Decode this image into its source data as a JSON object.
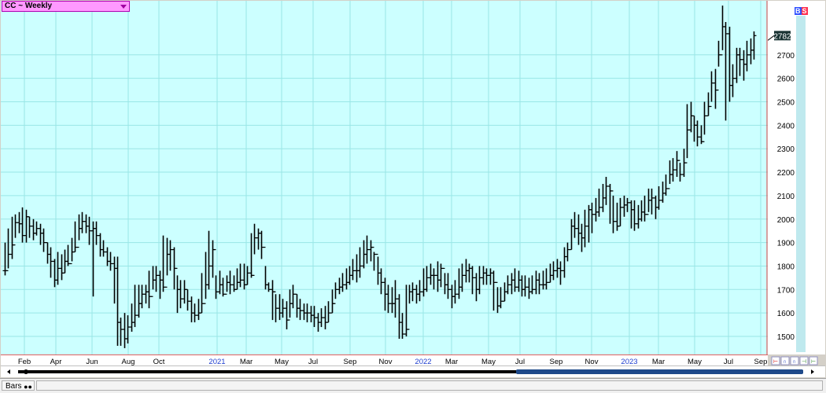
{
  "symbol_selector": {
    "label": "CC ~ Weekly"
  },
  "badges": {
    "buy": "B",
    "sell": "S"
  },
  "last_price_label": "2782",
  "bottom_tab": {
    "label": "Bars"
  },
  "colors": {
    "plot_bg": "#ccffff",
    "grid": "#99e6e6",
    "bars": "#000000",
    "price_badge": "#1a3333",
    "divider": "#e04040",
    "year_label": "#1f3fd0"
  },
  "chart_data": {
    "type": "ohlc",
    "title": "CC ~ Weekly",
    "xlabel": "",
    "ylabel": "",
    "ylim": [
      1450,
      2930
    ],
    "yticks": [
      1500,
      1600,
      1700,
      1800,
      1900,
      2000,
      2100,
      2200,
      2300,
      2400,
      2500,
      2600,
      2700
    ],
    "grid": true,
    "xticks": [
      "Feb",
      "Apr",
      "Jun",
      "Aug",
      "Oct",
      "2021",
      "Mar",
      "May",
      "Jul",
      "Sep",
      "Nov",
      "2022",
      "Mar",
      "May",
      "Jul",
      "Sep",
      "Nov",
      "2023",
      "Mar",
      "May",
      "Jul",
      "Sep"
    ],
    "year_ticks": [
      "2021",
      "2022",
      "2023"
    ],
    "last_price": 2782,
    "series": [
      {
        "closes": [
          1780,
          1850,
          1890,
          1985,
          1980,
          1930,
          2010,
          1970,
          1940,
          1960,
          1940,
          1900,
          1850,
          1820,
          1740,
          1790,
          1770,
          1820,
          1810,
          1860,
          1880,
          1960,
          1990,
          1970,
          1950,
          1960,
          1930,
          1870,
          1860,
          1820,
          1810,
          1790,
          1560,
          1530,
          1490,
          1540,
          1560,
          1590,
          1640,
          1680,
          1690,
          1670,
          1740,
          1760,
          1740,
          1710,
          1850,
          1870,
          1790,
          1700,
          1660,
          1700,
          1650,
          1600,
          1590,
          1600,
          1640,
          1720,
          1800,
          1870,
          1690,
          1720,
          1680,
          1730,
          1720,
          1700,
          1730,
          1740,
          1720,
          1770,
          1760,
          1920,
          1940,
          1880,
          1720,
          1700,
          1690,
          1620,
          1600,
          1620,
          1570,
          1640,
          1680,
          1620,
          1610,
          1600,
          1600,
          1590,
          1580,
          1560,
          1580,
          1560,
          1600,
          1640,
          1700,
          1710,
          1720,
          1730,
          1760,
          1780,
          1780,
          1800,
          1850,
          1870,
          1880,
          1850,
          1770,
          1730,
          1680,
          1640,
          1640,
          1660,
          1560,
          1510,
          1530,
          1690,
          1700,
          1680,
          1690,
          1700,
          1750,
          1760,
          1760,
          1740,
          1790,
          1720,
          1700,
          1670,
          1680,
          1710,
          1760,
          1780,
          1790,
          1750,
          1700,
          1750,
          1770,
          1760,
          1770,
          1730,
          1630,
          1650,
          1690,
          1720,
          1740,
          1710,
          1740,
          1700,
          1710,
          1690,
          1700,
          1740,
          1720,
          1720,
          1730,
          1760,
          1780,
          1790,
          1780,
          1840,
          1870,
          1970,
          1960,
          1940,
          1920,
          1970,
          2040,
          2020,
          2030,
          2050,
          2090,
          2140,
          2120,
          1990,
          1970,
          2050,
          2060,
          2070,
          2040,
          1980,
          2000,
          2030,
          2020,
          2080,
          2090,
          2050,
          2080,
          2110,
          2130,
          2190,
          2210,
          2250,
          2190,
          2240,
          2380,
          2440,
          2400,
          2350,
          2330,
          2440,
          2480,
          2580,
          2550,
          2700,
          2820,
          2790,
          2570,
          2600,
          2700,
          2680,
          2660,
          2700,
          2720,
          2782
        ],
        "highs": [
          1900,
          1960,
          2010,
          2020,
          2030,
          2050,
          2040,
          2010,
          2000,
          1990,
          1980,
          1960,
          1900,
          1880,
          1830,
          1860,
          1850,
          1870,
          1890,
          1920,
          1990,
          2020,
          2030,
          2020,
          2010,
          1990,
          1990,
          1940,
          1910,
          1880,
          1860,
          1840,
          1840,
          1580,
          1600,
          1590,
          1640,
          1720,
          1720,
          1720,
          1720,
          1780,
          1800,
          1800,
          1780,
          1930,
          1920,
          1910,
          1880,
          1760,
          1740,
          1740,
          1700,
          1670,
          1640,
          1660,
          1770,
          1860,
          1950,
          1910,
          1760,
          1780,
          1750,
          1760,
          1780,
          1760,
          1790,
          1810,
          1810,
          1800,
          1940,
          1980,
          1960,
          1950,
          1800,
          1730,
          1740,
          1680,
          1680,
          1660,
          1650,
          1700,
          1720,
          1680,
          1660,
          1640,
          1640,
          1630,
          1630,
          1600,
          1620,
          1630,
          1650,
          1700,
          1730,
          1750,
          1770,
          1790,
          1800,
          1830,
          1850,
          1880,
          1910,
          1930,
          1910,
          1860,
          1840,
          1790,
          1750,
          1720,
          1710,
          1740,
          1680,
          1600,
          1720,
          1720,
          1730,
          1720,
          1740,
          1790,
          1800,
          1810,
          1790,
          1820,
          1810,
          1770,
          1770,
          1720,
          1740,
          1790,
          1810,
          1830,
          1810,
          1800,
          1770,
          1800,
          1800,
          1790,
          1790,
          1780,
          1710,
          1710,
          1730,
          1760,
          1770,
          1790,
          1780,
          1760,
          1760,
          1750,
          1760,
          1780,
          1770,
          1780,
          1790,
          1810,
          1820,
          1830,
          1820,
          1880,
          1900,
          2000,
          2030,
          2020,
          1980,
          2040,
          2060,
          2070,
          2090,
          2130,
          2150,
          2180,
          2150,
          2100,
          2070,
          2090,
          2100,
          2090,
          2080,
          2080,
          2060,
          2080,
          2100,
          2130,
          2130,
          2100,
          2140,
          2160,
          2190,
          2250,
          2260,
          2290,
          2240,
          2300,
          2490,
          2500,
          2440,
          2420,
          2400,
          2500,
          2540,
          2630,
          2640,
          2760,
          2910,
          2840,
          2820,
          2660,
          2730,
          2730,
          2720,
          2760,
          2770,
          2800
        ],
        "lows": [
          1760,
          1790,
          1830,
          1920,
          1940,
          1900,
          1900,
          1920,
          1910,
          1930,
          1890,
          1860,
          1810,
          1750,
          1710,
          1720,
          1740,
          1770,
          1800,
          1820,
          1860,
          1910,
          1940,
          1940,
          1890,
          1670,
          1890,
          1840,
          1840,
          1800,
          1780,
          1640,
          1460,
          1460,
          1450,
          1470,
          1520,
          1540,
          1580,
          1620,
          1640,
          1620,
          1700,
          1690,
          1660,
          1690,
          1760,
          1780,
          1700,
          1600,
          1620,
          1640,
          1610,
          1560,
          1560,
          1570,
          1600,
          1660,
          1700,
          1750,
          1660,
          1680,
          1670,
          1690,
          1680,
          1690,
          1700,
          1710,
          1700,
          1720,
          1750,
          1850,
          1870,
          1830,
          1700,
          1690,
          1570,
          1560,
          1570,
          1580,
          1530,
          1580,
          1620,
          1580,
          1570,
          1570,
          1560,
          1560,
          1540,
          1520,
          1540,
          1530,
          1560,
          1600,
          1660,
          1680,
          1690,
          1700,
          1720,
          1740,
          1730,
          1750,
          1790,
          1810,
          1820,
          1780,
          1720,
          1680,
          1610,
          1600,
          1600,
          1580,
          1490,
          1490,
          1500,
          1640,
          1650,
          1640,
          1650,
          1670,
          1690,
          1720,
          1700,
          1690,
          1710,
          1680,
          1660,
          1620,
          1640,
          1660,
          1690,
          1730,
          1730,
          1680,
          1650,
          1680,
          1720,
          1720,
          1720,
          1610,
          1600,
          1620,
          1650,
          1680,
          1680,
          1690,
          1690,
          1670,
          1670,
          1660,
          1680,
          1680,
          1680,
          1700,
          1700,
          1730,
          1740,
          1750,
          1720,
          1750,
          1820,
          1870,
          1920,
          1890,
          1860,
          1880,
          1900,
          1940,
          1990,
          2010,
          2030,
          2060,
          1980,
          1940,
          1950,
          1970,
          2010,
          2030,
          1960,
          1950,
          1960,
          1990,
          1990,
          2030,
          2020,
          2000,
          2040,
          2070,
          2100,
          2150,
          2160,
          2180,
          2160,
          2180,
          2260,
          2370,
          2330,
          2310,
          2320,
          2360,
          2440,
          2500,
          2470,
          2650,
          2720,
          2420,
          2500,
          2520,
          2580,
          2610,
          2590,
          2630,
          2660,
          2680
        ]
      }
    ]
  }
}
